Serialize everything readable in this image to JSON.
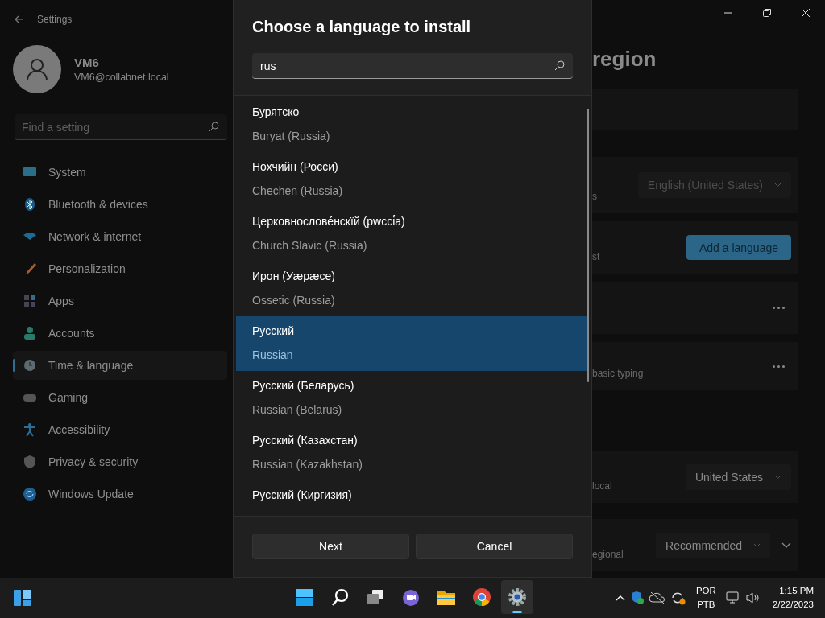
{
  "settings_window": {
    "title": "Settings",
    "user": {
      "name": "VM6",
      "email": "VM6@collabnet.local"
    },
    "search": {
      "placeholder": "Find a setting"
    },
    "nav": [
      {
        "label": "System",
        "selected": false
      },
      {
        "label": "Bluetooth & devices",
        "selected": false
      },
      {
        "label": "Network & internet",
        "selected": false
      },
      {
        "label": "Personalization",
        "selected": false
      },
      {
        "label": "Apps",
        "selected": false
      },
      {
        "label": "Accounts",
        "selected": false
      },
      {
        "label": "Time & language",
        "selected": true
      },
      {
        "label": "Gaming",
        "selected": false
      },
      {
        "label": "Accessibility",
        "selected": false
      },
      {
        "label": "Privacy & security",
        "selected": false
      },
      {
        "label": "Windows Update",
        "selected": false
      }
    ],
    "page_title": "region",
    "rows": [
      {
        "kind": "blank"
      },
      {
        "kind": "dropdown",
        "label": "s",
        "value": "English (United States)"
      },
      {
        "kind": "button",
        "label": "st",
        "button": "Add a language"
      },
      {
        "kind": "more"
      },
      {
        "kind": "more",
        "label": "basic typing"
      },
      {
        "kind": "dropdown",
        "label": "local",
        "value": "United States"
      },
      {
        "kind": "dropdown-expand",
        "label": "egional",
        "value": "Recommended"
      }
    ]
  },
  "dialog": {
    "title": "Choose a language to install",
    "search": {
      "value": "rus"
    },
    "languages": [
      {
        "native": "Бурятско",
        "english": "Buryat (Russia)",
        "selected": false
      },
      {
        "native": "Нохчийн (Росси)",
        "english": "Chechen (Russia)",
        "selected": false
      },
      {
        "native": "Церковнослове́нскїй (рwссі́а)",
        "english": "Church Slavic (Russia)",
        "selected": false
      },
      {
        "native": "Ирон (Уæрæсе)",
        "english": "Ossetic (Russia)",
        "selected": false
      },
      {
        "native": "Русский",
        "english": "Russian",
        "selected": true
      },
      {
        "native": "Русский (Беларусь)",
        "english": "Russian (Belarus)",
        "selected": false
      },
      {
        "native": "Русский (Казахстан)",
        "english": "Russian (Kazakhstan)",
        "selected": false
      },
      {
        "native": "Русский (Киргизия)",
        "selected": false
      }
    ],
    "buttons": [
      {
        "label": "Next"
      },
      {
        "label": "Cancel"
      }
    ]
  },
  "taskbar": {
    "apps": [
      {
        "selected": false
      },
      {
        "selected": false
      },
      {
        "selected": false
      },
      {
        "selected": false
      },
      {
        "selected": false
      },
      {
        "selected": false
      },
      {
        "selected": true
      }
    ],
    "input_language": {
      "line1": "POR",
      "line2": "PTB"
    },
    "clock": {
      "time": "1:15 PM",
      "date": "2/22/2023"
    }
  }
}
